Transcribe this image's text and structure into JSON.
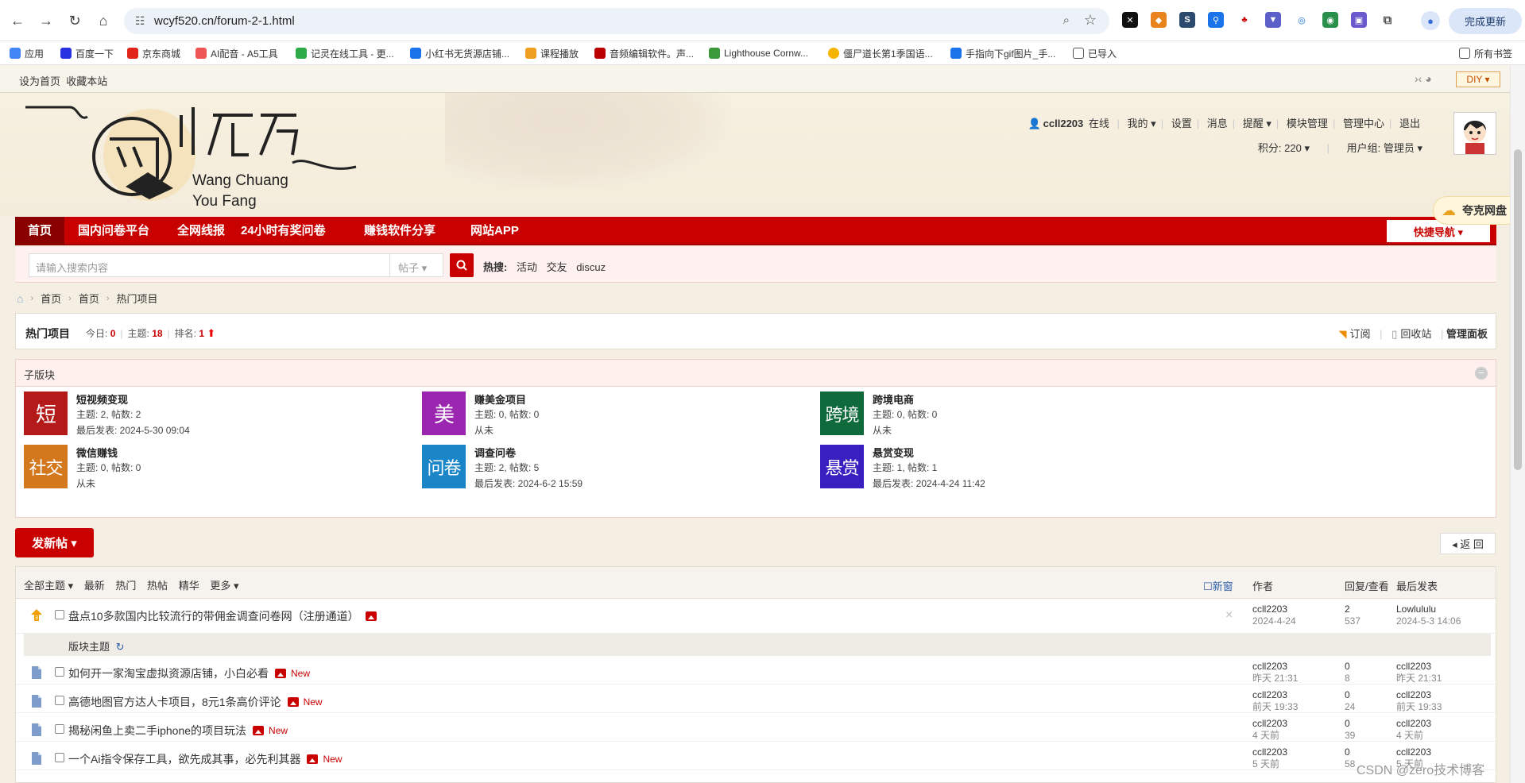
{
  "browser": {
    "url": "wcyf520.cn/forum-2-1.html",
    "update_label": "完成更新",
    "bookmarks": [
      "应用",
      "百度一下",
      "京东商城",
      "AI配音 - A5工具",
      "记灵在线工具 - 更...",
      "小红书无货源店铺...",
      "课程播放",
      "音频编辑软件。声...",
      "Lighthouse Cornw...",
      "僵尸道长第1季国语...",
      "手指向下gif图片_手...",
      "已导入",
      "所有书签"
    ]
  },
  "topbar": {
    "set_home": "设为首页",
    "bookmark_site": "收藏本站",
    "diy": "DIY ▾"
  },
  "logo": {
    "line1": "Wang Chuang",
    "line2": "You Fang"
  },
  "user": {
    "name": "ccll2203",
    "status": "在线",
    "links": [
      "我的 ▾",
      "设置",
      "消息",
      "提醒 ▾",
      "模块管理",
      "管理中心",
      "退出"
    ],
    "points": "积分: 220 ▾",
    "group": "用户组: 管理员 ▾"
  },
  "nav": {
    "items": [
      "首页",
      "国内问卷平台",
      "全网线报",
      "24小时有奖问卷",
      "赚钱软件分享",
      "网站APP"
    ],
    "quick": "快捷导航 ▾"
  },
  "cloud": {
    "label": "夸克网盘"
  },
  "search": {
    "placeholder": "请输入搜索内容",
    "type": "帖子 ▾",
    "hot_label": "热搜:",
    "hot": [
      "活动",
      "交友",
      "discuz"
    ]
  },
  "breadcrumb": [
    "首页",
    "首页",
    "热门项目"
  ],
  "forum": {
    "title": "热门项目",
    "today_label": "今日:",
    "today": "0",
    "topics_label": "主题:",
    "topics": "18",
    "rank_label": "排名:",
    "rank": "1",
    "subscribe": "订阅",
    "recycle": "回收站",
    "panel": "管理面板"
  },
  "subforums": {
    "title": "子版块",
    "items": [
      {
        "badge": "短",
        "color": "#b51a1a",
        "name": "短视频变现",
        "meta": "主题: 2, 帖数: 2",
        "last": "最后发表: 2024-5-30 09:04"
      },
      {
        "badge": "美",
        "color": "#9b27b0",
        "name": "赚美金项目",
        "meta": "主题: 0, 帖数: 0",
        "last": "从未"
      },
      {
        "badge": "跨境",
        "color": "#0f6b3c",
        "name": "跨境电商",
        "meta": "主题: 0, 帖数: 0",
        "last": "从未"
      },
      {
        "badge": "社交",
        "color": "#d4781e",
        "name": "微信赚钱",
        "meta": "主题: 0, 帖数: 0",
        "last": "从未"
      },
      {
        "badge": "问卷",
        "color": "#1a86c8",
        "name": "调查问卷",
        "meta": "主题: 2, 帖数: 5",
        "last": "最后发表: 2024-6-2 15:59"
      },
      {
        "badge": "悬赏",
        "color": "#3a1fc0",
        "name": "悬赏变现",
        "meta": "主题: 1, 帖数: 1",
        "last": "最后发表: 2024-4-24 11:42"
      }
    ]
  },
  "actions": {
    "new_post": "发新帖 ▾",
    "back": "◂ 返 回"
  },
  "threads": {
    "filters": [
      "全部主题 ▾",
      "最新",
      "热门",
      "热帖",
      "精华",
      "更多 ▾"
    ],
    "new_window": "新窗",
    "col_author": "作者",
    "col_replies": "回复/查看",
    "col_last": "最后发表",
    "section_label": "版块主题",
    "new_tag": "New",
    "sticky": {
      "title": "盘点10多款国内比较流行的带佣金调查问卷网（注册通道）",
      "author": "ccll2203",
      "date": "2024-4-24",
      "replies": "2",
      "views": "537",
      "last_user": "Lowlululu",
      "last_date": "2024-5-3 14:06"
    },
    "rows": [
      {
        "title": "如何开一家淘宝虚拟资源店铺，小白必看",
        "author": "ccll2203",
        "date": "昨天 21:31",
        "replies": "0",
        "views": "8",
        "last_user": "ccll2203",
        "last_date": "昨天 21:31"
      },
      {
        "title": "高德地图官方达人卡项目，8元1条高价评论",
        "author": "ccll2203",
        "date": "前天 19:33",
        "replies": "0",
        "views": "24",
        "last_user": "ccll2203",
        "last_date": "前天 19:33"
      },
      {
        "title": "揭秘闲鱼上卖二手iphone的项目玩法",
        "author": "ccll2203",
        "date": "4 天前",
        "replies": "0",
        "views": "39",
        "last_user": "ccll2203",
        "last_date": "4 天前"
      },
      {
        "title": "一个Ai指令保存工具，欲先成其事，必先利其器",
        "author": "ccll2203",
        "date": "5 天前",
        "replies": "0",
        "views": "58",
        "last_user": "ccll2203",
        "last_date": "5 天前"
      }
    ]
  },
  "watermark": "CSDN @zero技术博客"
}
